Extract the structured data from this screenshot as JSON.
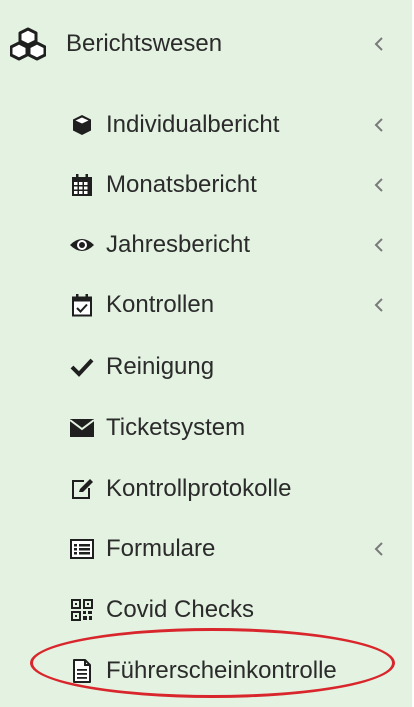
{
  "sidebar": {
    "section": {
      "label": "Berichtswesen",
      "icon": "cubes-icon"
    },
    "items": [
      {
        "label": "Individualbericht",
        "icon": "cube-icon",
        "has_submenu": true
      },
      {
        "label": "Monatsbericht",
        "icon": "calendar-icon",
        "has_submenu": true
      },
      {
        "label": "Jahresbericht",
        "icon": "eye-icon",
        "has_submenu": true
      },
      {
        "label": "Kontrollen",
        "icon": "calendar-check-icon",
        "has_submenu": true
      },
      {
        "label": "Reinigung",
        "icon": "check-icon",
        "has_submenu": false
      },
      {
        "label": "Ticketsystem",
        "icon": "envelope-icon",
        "has_submenu": false
      },
      {
        "label": "Kontrollprotokolle",
        "icon": "edit-icon",
        "has_submenu": false
      },
      {
        "label": "Formulare",
        "icon": "list-alt-icon",
        "has_submenu": true
      },
      {
        "label": "Covid Checks",
        "icon": "qrcode-icon",
        "has_submenu": false
      },
      {
        "label": "Führerscheinkontrolle",
        "icon": "file-text-icon",
        "has_submenu": false
      }
    ]
  },
  "colors": {
    "background": "#e3f2e1",
    "text": "#2b2b2b",
    "highlight": "#d9262c"
  }
}
